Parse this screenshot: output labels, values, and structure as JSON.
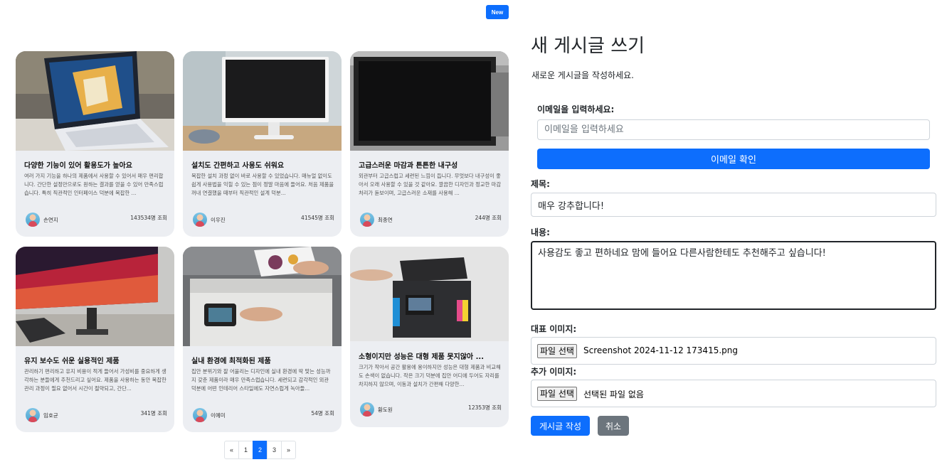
{
  "header": {
    "new_button_label": "New"
  },
  "cards": [
    {
      "title": "다양한 기능이 있어 활용도가 높아요",
      "description": "여러 가지 기능을 하나의 제품에서 사용할 수 있어서 매우 편리합니다. 간단한 설정만으로도 원하는 결과를 얻을 수 있어 만족스럽습니다. 특히 직관적인 인터페이스 덕분에 복잡한 ...",
      "author": "손연지",
      "views": "143534명 조회"
    },
    {
      "title": "설치도 간편하고 사용도 쉬워요",
      "description": "복잡한 설치 과정 없이 바로 사용할 수 있었습니다. 매뉴얼 없이도 쉽게 사용법을 익힐 수 있는 점이 정말 마음에 들어요. 처음 제품을 꺼내 연결했을 때부터 직관적인 설계 덕분...",
      "author": "이우진",
      "views": "41545명 조회"
    },
    {
      "title": "고급스러운 마감과 튼튼한 내구성",
      "description": "외관부터 고급스럽고 세련된 느낌이 듭니다. 무엇보다 내구성이 좋아서 오래 사용할 수 있을 것 같아요. 깔끔한 디자인과 정교한 마감 처리가 돋보이며, 고급스러운 소재를 사용해 ...",
      "author": "최종연",
      "views": "244명 조회"
    },
    {
      "title": "유지 보수도 쉬운 실용적인 제품",
      "description": "관리하기 편리하고 유지 비용이 적게 들어서 가성비를 중요하게 생각하는 분들에게 추천드리고 싶어요. 제품을 사용하는 동안 복잡한 관리 과정이 필요 없어서 시간이 절약되고, 간단...",
      "author": "임호균",
      "views": "341명 조회"
    },
    {
      "title": "실내 환경에 최적화된 제품",
      "description": "집안 분위기와 잘 어울리는 디자인에 실내 환경에 딱 맞는 성능까지 갖춘 제품이라 매우 만족스럽습니다. 세련되고 감각적인 외관 덕분에 어떤 인테리어 스타일에도 자연스럽게 녹아들...",
      "author": "이예미",
      "views": "54명 조회"
    },
    {
      "title": "소형이지만 성능은 대형 제품 못지않아 ...",
      "description": "크기가 작아서 공간 활용에 용이하지만 성능은 대형 제품과 비교해도 손색이 없습니다. 작은 크기 덕분에 집안 어디에 두어도 자리를 차지하지 않으며, 이동과 설치가 간편해 다양한...",
      "author": "황도원",
      "views": "12353명 조회"
    }
  ],
  "pagination": {
    "prev": "«",
    "pages": [
      "1",
      "2",
      "3"
    ],
    "current_page": "2",
    "next": "»"
  },
  "form": {
    "title": "새 게시글 쓰기",
    "subtitle": "새로운 게시글을 작성하세요.",
    "email_label": "이메일을 입력하세요:",
    "email_placeholder": "이메일을 입력하세요",
    "email_confirm_button": "이메일 확인",
    "subject_label": "제목:",
    "subject_value": "매우 강추합니다!",
    "content_label": "내용:",
    "content_value": "사용감도 좋고 편하네요 맘에 들어요 다른사람한테도 추천해주고 싶습니다!",
    "main_image_label": "대표 이미지:",
    "main_image_button": "파일 선택",
    "main_image_filename": "Screenshot 2024-11-12 173415.png",
    "extra_image_label": "추가 이미지:",
    "extra_image_button": "파일 선택",
    "extra_image_filename": "선택된 파일 없음",
    "submit_button": "게시글 작성",
    "cancel_button": "취소"
  },
  "colors": {
    "primary": "#0d6efd",
    "secondary": "#6c757d",
    "card_bg": "#eceef2"
  }
}
